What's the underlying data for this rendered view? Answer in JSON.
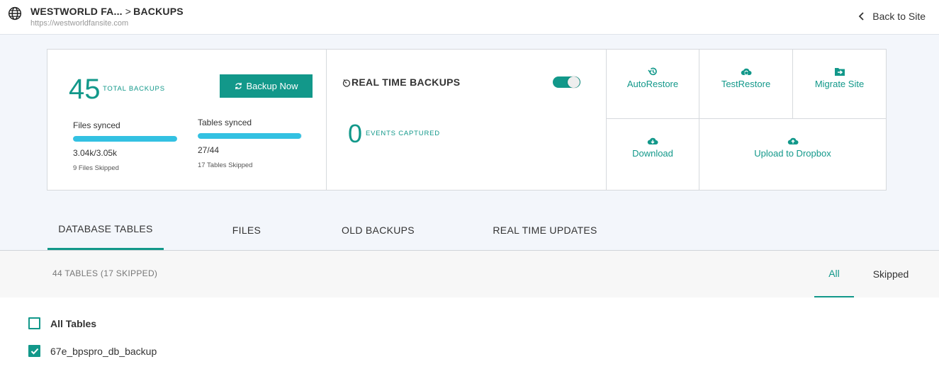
{
  "header": {
    "site_name": "WESTWORLD FA...",
    "separator": ">",
    "section": "BACKUPS",
    "site_url": "https://westworldfansite.com",
    "back_label": "Back to Site"
  },
  "summary": {
    "total_backups": "45",
    "total_label": "TOTAL BACKUPS",
    "backup_button": "Backup Now",
    "files": {
      "label": "Files synced",
      "count": "3.04k/3.05k",
      "skipped": "9 Files Skipped",
      "progress": 0.997
    },
    "tables": {
      "label": "Tables synced",
      "count": "27/44",
      "skipped": "17 Tables Skipped",
      "progress": 0.99
    }
  },
  "realtime": {
    "title": "REAL TIME BACKUPS",
    "enabled": true,
    "events_count": "0",
    "events_label": "EVENTS CAPTURED"
  },
  "actions": {
    "autorestore": "AutoRestore",
    "testrestore": "TestRestore",
    "migrate": "Migrate Site",
    "download": "Download",
    "dropbox": "Upload to Dropbox"
  },
  "tabs": [
    {
      "label": "DATABASE TABLES",
      "active": true
    },
    {
      "label": "FILES",
      "active": false
    },
    {
      "label": "OLD BACKUPS",
      "active": false
    },
    {
      "label": "REAL TIME UPDATES",
      "active": false
    }
  ],
  "filter": {
    "count_label": "44 TABLES (17 SKIPPED)",
    "all": "All",
    "skipped": "Skipped",
    "selected": "All"
  },
  "tables_list": {
    "all_label": "All Tables",
    "all_checked": false,
    "items": [
      {
        "name": "67e_bpspro_db_backup",
        "checked": true
      }
    ]
  },
  "colors": {
    "accent": "#12988a",
    "progress": "#33c1e2"
  },
  "icons": {
    "globe": "globe-icon",
    "back": "chevron-left-icon",
    "sync": "sync-icon",
    "timer": "timer-icon",
    "autorestore": "history-icon",
    "testrestore": "cloud-sync-icon",
    "migrate": "folder-arrow-icon",
    "download": "cloud-download-icon",
    "dropbox": "cloud-upload-icon"
  }
}
